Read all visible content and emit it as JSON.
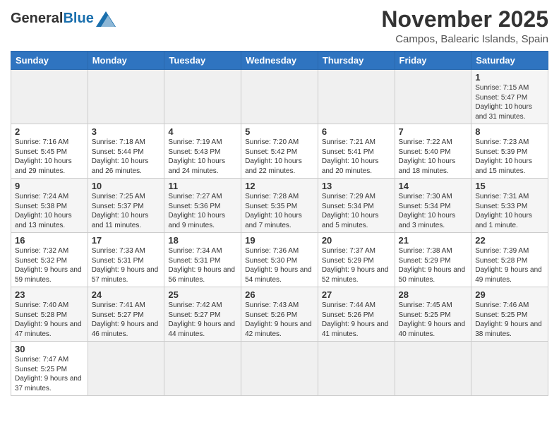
{
  "header": {
    "logo_general": "General",
    "logo_blue": "Blue",
    "month_title": "November 2025",
    "location": "Campos, Balearic Islands, Spain"
  },
  "weekdays": [
    "Sunday",
    "Monday",
    "Tuesday",
    "Wednesday",
    "Thursday",
    "Friday",
    "Saturday"
  ],
  "weeks": [
    [
      {
        "day": "",
        "info": ""
      },
      {
        "day": "",
        "info": ""
      },
      {
        "day": "",
        "info": ""
      },
      {
        "day": "",
        "info": ""
      },
      {
        "day": "",
        "info": ""
      },
      {
        "day": "",
        "info": ""
      },
      {
        "day": "1",
        "info": "Sunrise: 7:15 AM\nSunset: 5:47 PM\nDaylight: 10 hours and 31 minutes."
      }
    ],
    [
      {
        "day": "2",
        "info": "Sunrise: 7:16 AM\nSunset: 5:45 PM\nDaylight: 10 hours and 29 minutes."
      },
      {
        "day": "3",
        "info": "Sunrise: 7:18 AM\nSunset: 5:44 PM\nDaylight: 10 hours and 26 minutes."
      },
      {
        "day": "4",
        "info": "Sunrise: 7:19 AM\nSunset: 5:43 PM\nDaylight: 10 hours and 24 minutes."
      },
      {
        "day": "5",
        "info": "Sunrise: 7:20 AM\nSunset: 5:42 PM\nDaylight: 10 hours and 22 minutes."
      },
      {
        "day": "6",
        "info": "Sunrise: 7:21 AM\nSunset: 5:41 PM\nDaylight: 10 hours and 20 minutes."
      },
      {
        "day": "7",
        "info": "Sunrise: 7:22 AM\nSunset: 5:40 PM\nDaylight: 10 hours and 18 minutes."
      },
      {
        "day": "8",
        "info": "Sunrise: 7:23 AM\nSunset: 5:39 PM\nDaylight: 10 hours and 15 minutes."
      }
    ],
    [
      {
        "day": "9",
        "info": "Sunrise: 7:24 AM\nSunset: 5:38 PM\nDaylight: 10 hours and 13 minutes."
      },
      {
        "day": "10",
        "info": "Sunrise: 7:25 AM\nSunset: 5:37 PM\nDaylight: 10 hours and 11 minutes."
      },
      {
        "day": "11",
        "info": "Sunrise: 7:27 AM\nSunset: 5:36 PM\nDaylight: 10 hours and 9 minutes."
      },
      {
        "day": "12",
        "info": "Sunrise: 7:28 AM\nSunset: 5:35 PM\nDaylight: 10 hours and 7 minutes."
      },
      {
        "day": "13",
        "info": "Sunrise: 7:29 AM\nSunset: 5:34 PM\nDaylight: 10 hours and 5 minutes."
      },
      {
        "day": "14",
        "info": "Sunrise: 7:30 AM\nSunset: 5:34 PM\nDaylight: 10 hours and 3 minutes."
      },
      {
        "day": "15",
        "info": "Sunrise: 7:31 AM\nSunset: 5:33 PM\nDaylight: 10 hours and 1 minute."
      }
    ],
    [
      {
        "day": "16",
        "info": "Sunrise: 7:32 AM\nSunset: 5:32 PM\nDaylight: 9 hours and 59 minutes."
      },
      {
        "day": "17",
        "info": "Sunrise: 7:33 AM\nSunset: 5:31 PM\nDaylight: 9 hours and 57 minutes."
      },
      {
        "day": "18",
        "info": "Sunrise: 7:34 AM\nSunset: 5:31 PM\nDaylight: 9 hours and 56 minutes."
      },
      {
        "day": "19",
        "info": "Sunrise: 7:36 AM\nSunset: 5:30 PM\nDaylight: 9 hours and 54 minutes."
      },
      {
        "day": "20",
        "info": "Sunrise: 7:37 AM\nSunset: 5:29 PM\nDaylight: 9 hours and 52 minutes."
      },
      {
        "day": "21",
        "info": "Sunrise: 7:38 AM\nSunset: 5:29 PM\nDaylight: 9 hours and 50 minutes."
      },
      {
        "day": "22",
        "info": "Sunrise: 7:39 AM\nSunset: 5:28 PM\nDaylight: 9 hours and 49 minutes."
      }
    ],
    [
      {
        "day": "23",
        "info": "Sunrise: 7:40 AM\nSunset: 5:28 PM\nDaylight: 9 hours and 47 minutes."
      },
      {
        "day": "24",
        "info": "Sunrise: 7:41 AM\nSunset: 5:27 PM\nDaylight: 9 hours and 46 minutes."
      },
      {
        "day": "25",
        "info": "Sunrise: 7:42 AM\nSunset: 5:27 PM\nDaylight: 9 hours and 44 minutes."
      },
      {
        "day": "26",
        "info": "Sunrise: 7:43 AM\nSunset: 5:26 PM\nDaylight: 9 hours and 42 minutes."
      },
      {
        "day": "27",
        "info": "Sunrise: 7:44 AM\nSunset: 5:26 PM\nDaylight: 9 hours and 41 minutes."
      },
      {
        "day": "28",
        "info": "Sunrise: 7:45 AM\nSunset: 5:25 PM\nDaylight: 9 hours and 40 minutes."
      },
      {
        "day": "29",
        "info": "Sunrise: 7:46 AM\nSunset: 5:25 PM\nDaylight: 9 hours and 38 minutes."
      }
    ],
    [
      {
        "day": "30",
        "info": "Sunrise: 7:47 AM\nSunset: 5:25 PM\nDaylight: 9 hours and 37 minutes."
      },
      {
        "day": "",
        "info": ""
      },
      {
        "day": "",
        "info": ""
      },
      {
        "day": "",
        "info": ""
      },
      {
        "day": "",
        "info": ""
      },
      {
        "day": "",
        "info": ""
      },
      {
        "day": "",
        "info": ""
      }
    ]
  ]
}
